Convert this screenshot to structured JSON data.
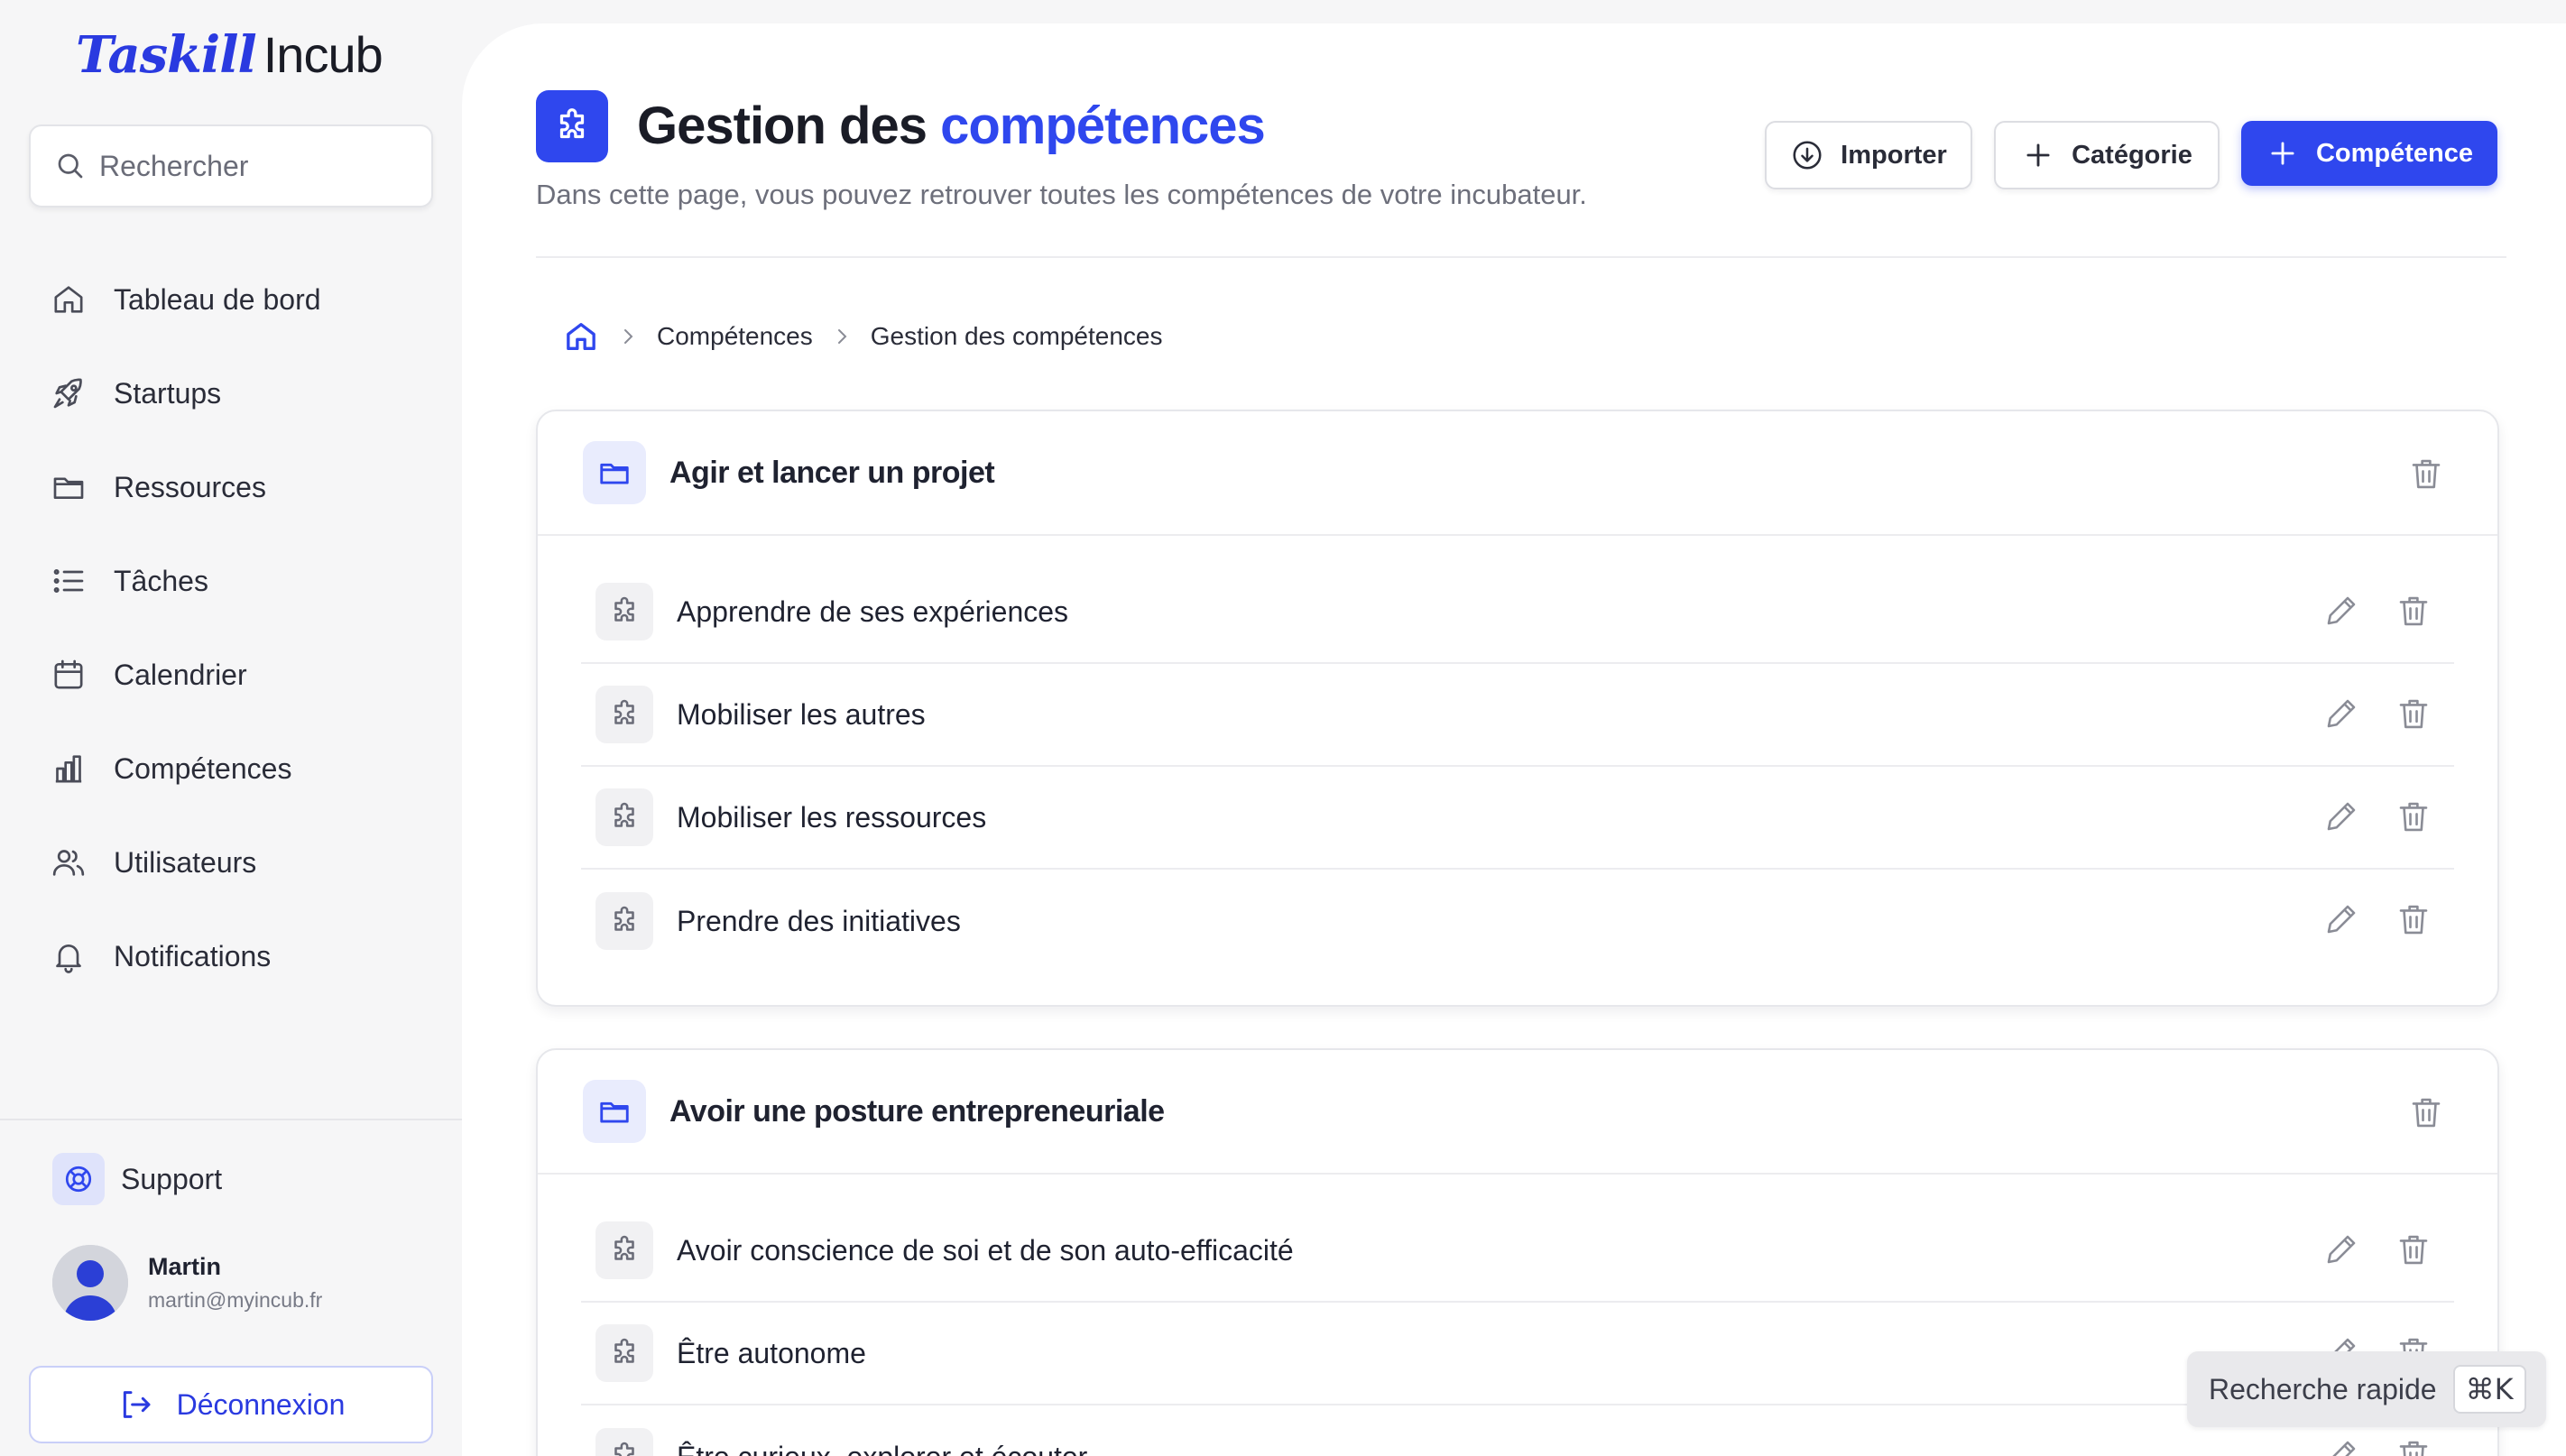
{
  "sidebar": {
    "logo_brand": "Taskill",
    "logo_product": "Incub",
    "search_placeholder": "Rechercher",
    "nav": [
      {
        "label": "Tableau de bord",
        "icon": "home-icon"
      },
      {
        "label": "Startups",
        "icon": "rocket-icon"
      },
      {
        "label": "Ressources",
        "icon": "folder-icon"
      },
      {
        "label": "Tâches",
        "icon": "list-icon"
      },
      {
        "label": "Calendrier",
        "icon": "calendar-icon"
      },
      {
        "label": "Compétences",
        "icon": "bar-chart-icon"
      },
      {
        "label": "Utilisateurs",
        "icon": "users-icon"
      },
      {
        "label": "Notifications",
        "icon": "bell-icon"
      }
    ],
    "support_label": "Support",
    "user": {
      "name": "Martin",
      "email": "martin@myincub.fr"
    },
    "logout_label": "Déconnexion"
  },
  "header": {
    "title_prefix": "Gestion des ",
    "title_accent": "compétences",
    "subtitle": "Dans cette page, vous pouvez retrouver toutes les compétences de votre incubateur.",
    "buttons": {
      "import": "Importer",
      "category": "Catégorie",
      "skill": "Compétence"
    }
  },
  "breadcrumb": {
    "level1": "Compétences",
    "level2": "Gestion des compétences"
  },
  "categories": [
    {
      "title": "Agir et lancer un projet",
      "skills": [
        "Apprendre de ses expériences",
        "Mobiliser les autres",
        "Mobiliser les ressources",
        "Prendre des initiatives"
      ]
    },
    {
      "title": "Avoir une posture entrepreneuriale",
      "skills": [
        "Avoir conscience de soi et de son auto-efficacité",
        "Être autonome",
        "Être curieux, explorer et écouter"
      ]
    }
  ],
  "quick_search": {
    "label": "Recherche rapide",
    "shortcut": "⌘K"
  },
  "colors": {
    "accent": "#2f47ee",
    "background": "#f6f6f7",
    "text": "#1f2230"
  }
}
